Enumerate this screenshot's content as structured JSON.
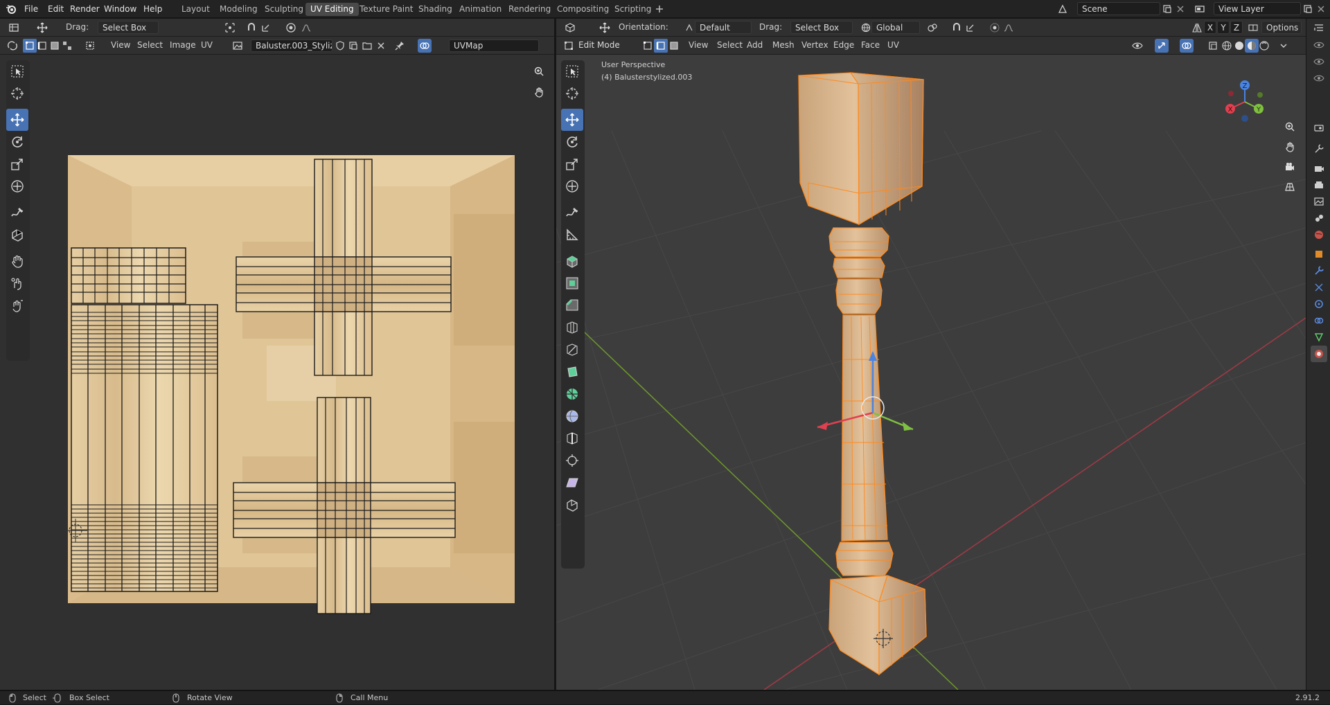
{
  "topbar": {
    "menus": [
      "File",
      "Edit",
      "Render",
      "Window",
      "Help"
    ],
    "workspaces": [
      "Layout",
      "Modeling",
      "Sculpting",
      "UV Editing",
      "Texture Paint",
      "Shading",
      "Animation",
      "Rendering",
      "Compositing",
      "Scripting"
    ],
    "active_workspace": "UV Editing",
    "scene": "Scene",
    "view_layer": "View Layer"
  },
  "uv_editor": {
    "drag_label": "Drag:",
    "drag_value": "Select Box",
    "menus": [
      "View",
      "Select",
      "Image",
      "UV"
    ],
    "image_name": "Baluster.003_Styliz...",
    "uvmap": "UVMap"
  },
  "viewport": {
    "orientation_label": "Orientation:",
    "orientation_value": "Default",
    "drag_label": "Drag:",
    "drag_value": "Select Box",
    "transform_space": "Global",
    "options": "Options",
    "mode": "Edit Mode",
    "menus": [
      "View",
      "Select",
      "Add",
      "Mesh",
      "Vertex",
      "Edge",
      "Face",
      "UV"
    ],
    "axis_toggles": [
      "X",
      "Y",
      "Z"
    ],
    "overlay_title": "User Perspective",
    "overlay_object": "(4) Balusterstylized.003",
    "gizmo_axes": [
      "Z",
      "X",
      "Y"
    ]
  },
  "statusbar": {
    "items": [
      "Select",
      "Box Select",
      "Rotate View",
      "Call Menu"
    ],
    "version": "2.91.2"
  },
  "colors": {
    "accent": "#4772b3",
    "selection_orange": "#ff8a1e",
    "wood": "#e2c69a",
    "grid_x": "#a33a46",
    "grid_y": "#6e9a2a"
  }
}
